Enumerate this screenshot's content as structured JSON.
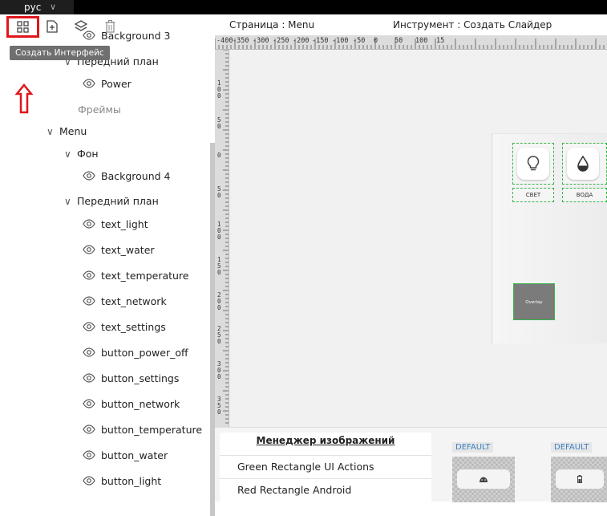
{
  "topbar": {
    "language": "рус"
  },
  "toolbar": {
    "tooltip": "Создать Интерфейс"
  },
  "tree": [
    {
      "label": "Background 3",
      "kind": "leaf"
    },
    {
      "label": "Передний план",
      "kind": "group"
    },
    {
      "label": "Power",
      "kind": "leaf"
    },
    {
      "label": "Фреймы",
      "kind": "section"
    },
    {
      "label": "Menu",
      "kind": "group"
    },
    {
      "label": "Фон",
      "kind": "group"
    },
    {
      "label": "Background 4",
      "kind": "leaf"
    },
    {
      "label": "Передний план",
      "kind": "group"
    },
    {
      "label": "text_light",
      "kind": "leaf"
    },
    {
      "label": "text_water",
      "kind": "leaf"
    },
    {
      "label": "text_temperature",
      "kind": "leaf"
    },
    {
      "label": "text_network",
      "kind": "leaf"
    },
    {
      "label": "text_settings",
      "kind": "leaf"
    },
    {
      "label": "button_power_off",
      "kind": "leaf"
    },
    {
      "label": "button_settings",
      "kind": "leaf"
    },
    {
      "label": "button_network",
      "kind": "leaf"
    },
    {
      "label": "button_temperature",
      "kind": "leaf"
    },
    {
      "label": "button_water",
      "kind": "leaf"
    },
    {
      "label": "button_light",
      "kind": "leaf"
    }
  ],
  "header": {
    "page": "Страница : Menu",
    "tool": "Инструмент : Создать Слайдер"
  },
  "ruler_top": [
    "-400",
    "-350",
    "-300",
    "-250",
    "-200",
    "-150",
    "-100",
    "-50",
    "0",
    "50",
    "100",
    "15"
  ],
  "ruler_left": [
    "100",
    "50",
    "0",
    "50",
    "100",
    "150",
    "200",
    "250",
    "300",
    "350",
    "4"
  ],
  "canvas": {
    "tile_light": "СВЕТ",
    "tile_water": "ВОДА",
    "overlay": "Overlay"
  },
  "image_manager": {
    "title": "Менеджер изображений",
    "items": [
      "Green Rectangle UI Actions",
      "Red Rectangle Android"
    ],
    "default_label_1": "DEFAULT",
    "default_label_2": "DEFAULT"
  },
  "colors": {
    "highlight": "#e0161b",
    "selection_dashed": "#39b54a",
    "link_blue": "#3b7fc4"
  }
}
